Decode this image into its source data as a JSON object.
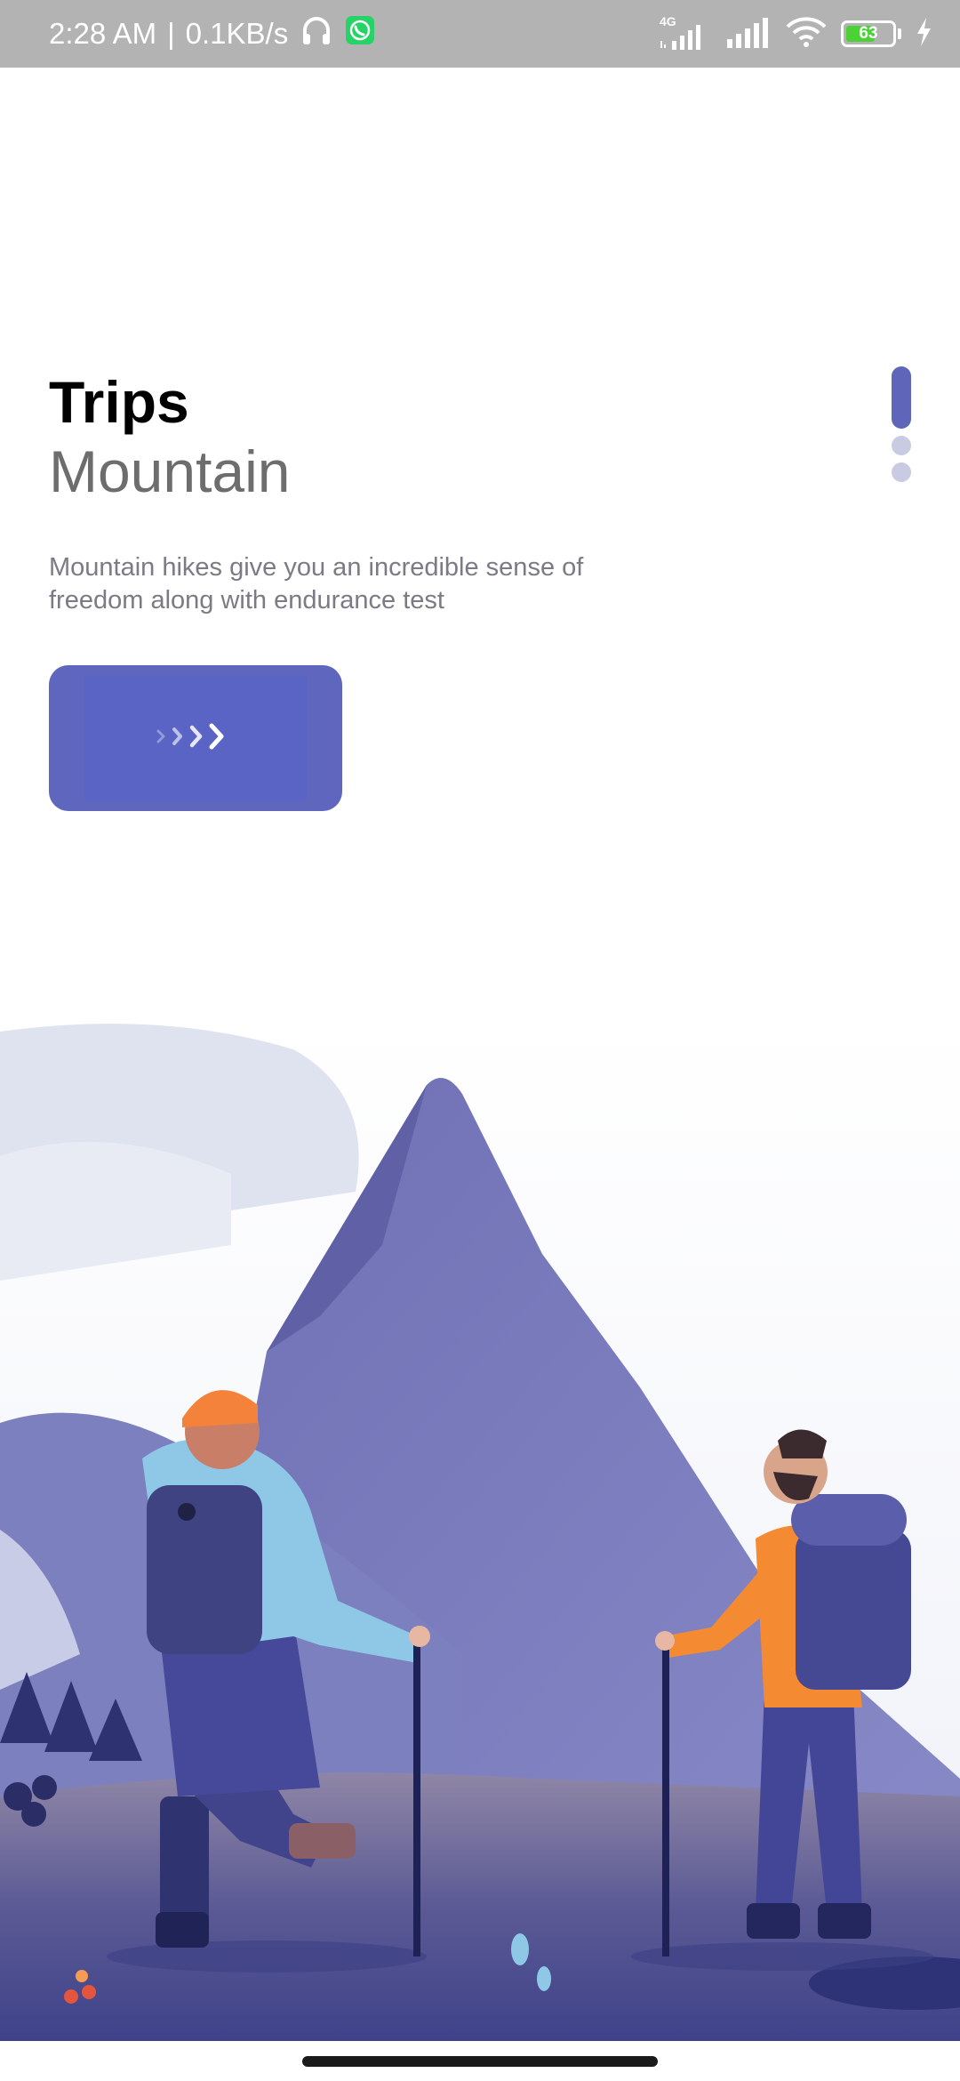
{
  "status_bar": {
    "time": "2:28 AM",
    "separator": "|",
    "speed": "0.1KB/s",
    "network_label": "4G",
    "battery_level": "63",
    "battery_fraction": 0.63,
    "icons": [
      "headphones-icon",
      "whatsapp-icon",
      "signal-4g-icon",
      "signal-icon",
      "wifi-icon",
      "battery-icon",
      "charging-icon"
    ]
  },
  "onboarding": {
    "title": "Trips",
    "subtitle": "Mountain",
    "description": "Mountain hikes give you an incredible sense of freedom along with endurance test",
    "next_button_icon": "chevrons-right-icon",
    "page_indicator": {
      "total": 3,
      "current": 1
    }
  },
  "colors": {
    "accent": "#5e66bd",
    "indicator_active": "#5d66b8",
    "indicator_inactive": "#c9cbe3",
    "title": "#000000",
    "subtitle": "#6d6d6d",
    "description": "#7b7b85",
    "status_bar": "#b3b3b3"
  }
}
